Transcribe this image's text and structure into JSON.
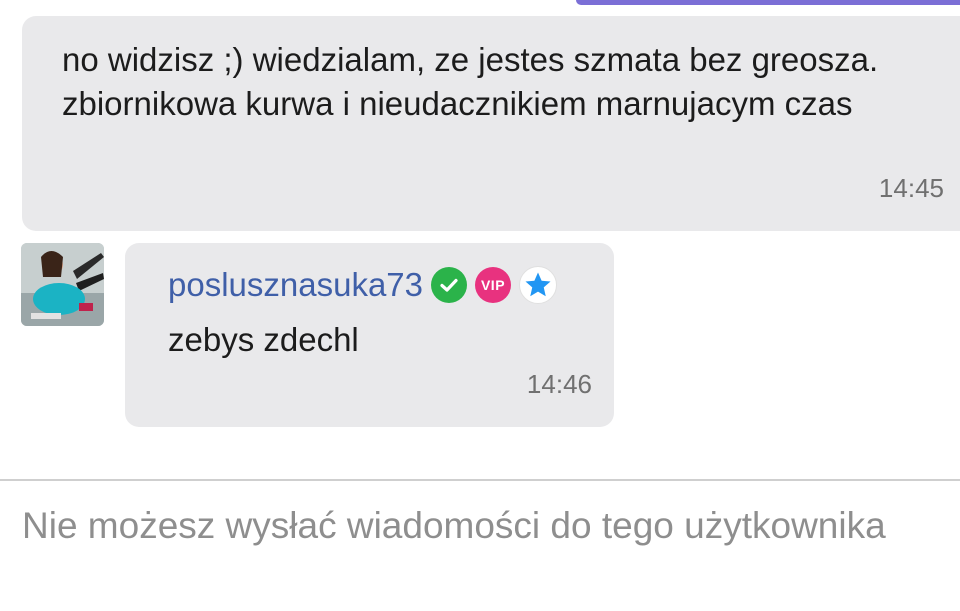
{
  "messages": {
    "previous": {
      "text": "no widzisz ;) wiedzialam, ze jestes szmata bez greosza. zbiornikowa kurwa i nieudacznikiem marnujacym czas",
      "time": "14:45"
    },
    "reply": {
      "sender": "poslusznasuka73",
      "badges": {
        "verified_icon": "check-circle-icon",
        "vip_label": "VIP",
        "star_icon": "star-icon"
      },
      "text": "zebys zdechl",
      "time": "14:46"
    }
  },
  "composer": {
    "blocked_notice": "Nie możesz wysłać wiadomości do tego użytkownika"
  },
  "colors": {
    "accent": "#7b6fd6",
    "bubble": "#e9e9eb",
    "sender_name": "#3f5fa8",
    "verified": "#2bb34a",
    "vip": "#e8327f",
    "star": "#2196f3"
  }
}
